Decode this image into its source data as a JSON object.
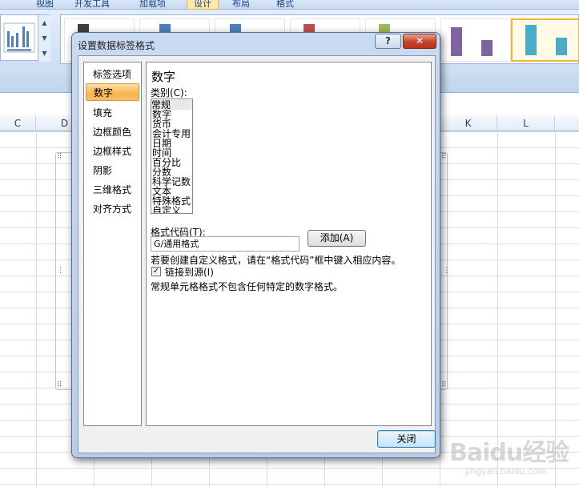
{
  "ribbon": {
    "tabs": [
      "视图",
      "开发工具",
      "加载项",
      "设计",
      "布局",
      "格式"
    ],
    "active_tab_index": 3
  },
  "columns": [
    "C",
    "D",
    "K",
    "L"
  ],
  "dialog": {
    "title": "设置数据标签格式",
    "help_symbol": "?",
    "close_symbol": "✕",
    "categories": [
      "标签选项",
      "数字",
      "填充",
      "边框颜色",
      "边框样式",
      "阴影",
      "三维格式",
      "对齐方式"
    ],
    "selected_category_index": 1,
    "section_title": "数字",
    "type_label": "类别(C):",
    "types": [
      "常规",
      "数字",
      "货币",
      "会计专用",
      "日期",
      "时间",
      "百分比",
      "分数",
      "科学记数",
      "文本",
      "特殊格式",
      "自定义"
    ],
    "selected_type_index": 0,
    "format_code_label": "格式代码(T):",
    "format_code_value": "G/通用格式",
    "add_button": "添加(A)",
    "hint": "若要创建自定义格式，请在“格式代码”框中键入相应内容。",
    "link_checkbox_label": "链接到源(I)",
    "link_checked": true,
    "check_mark": "✓",
    "description": "常规单元格格式不包含任何特定的数字格式。",
    "close_button": "关闭"
  },
  "watermark": {
    "brand": "Baidu经验",
    "url": "jingyan.baidu.com"
  },
  "colors": {
    "selected_category": "#f8b450",
    "gallery_bars": [
      "#404040",
      "#4f81bd",
      "#4f81bd",
      "#c0504d",
      "#9bbb59",
      "#8064a2",
      "#4bacc6"
    ]
  }
}
